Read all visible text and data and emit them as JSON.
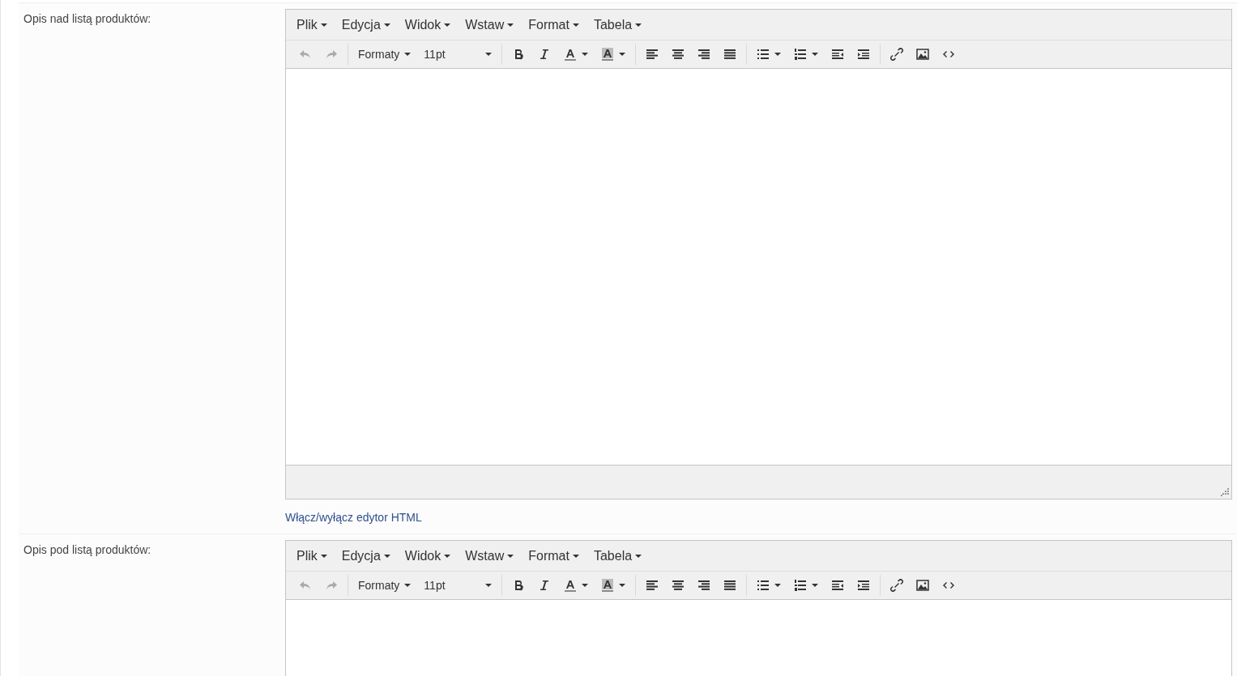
{
  "fields": [
    {
      "label": "Opis nad listą produktów:",
      "editor": {
        "menu": [
          "Plik",
          "Edycja",
          "Widok",
          "Wstaw",
          "Format",
          "Tabela"
        ],
        "toolbar": [
          {
            "items": [
              {
                "kind": "undo",
                "disabled": true
              },
              {
                "kind": "redo",
                "disabled": true
              }
            ]
          },
          {
            "items": [
              {
                "kind": "menu",
                "label": "Formaty",
                "disabled": false
              },
              {
                "kind": "select",
                "label": "11pt",
                "disabled": false
              }
            ]
          },
          {
            "items": [
              {
                "kind": "bold",
                "disabled": false
              },
              {
                "kind": "italic",
                "disabled": false
              },
              {
                "kind": "forecolor",
                "disabled": false
              },
              {
                "kind": "backcolor",
                "disabled": false
              }
            ]
          },
          {
            "items": [
              {
                "kind": "alignleft",
                "disabled": false
              },
              {
                "kind": "aligncenter",
                "disabled": false
              },
              {
                "kind": "alignright",
                "disabled": false
              },
              {
                "kind": "justify",
                "disabled": false
              }
            ]
          },
          {
            "items": [
              {
                "kind": "bullist",
                "disabled": false
              },
              {
                "kind": "numlist",
                "disabled": false
              },
              {
                "kind": "outdent",
                "disabled": false
              },
              {
                "kind": "indent",
                "disabled": false
              }
            ]
          },
          {
            "items": [
              {
                "kind": "link",
                "disabled": false
              },
              {
                "kind": "image",
                "disabled": false
              },
              {
                "kind": "code",
                "disabled": false
              }
            ]
          }
        ],
        "statusbar": true
      },
      "toggle_link": "Włącz/wyłącz edytor HTML"
    },
    {
      "label": "Opis pod listą produktów:",
      "editor": {
        "menu": [
          "Plik",
          "Edycja",
          "Widok",
          "Wstaw",
          "Format",
          "Tabela"
        ],
        "toolbar": [
          {
            "items": [
              {
                "kind": "undo",
                "disabled": true
              },
              {
                "kind": "redo",
                "disabled": true
              }
            ]
          },
          {
            "items": [
              {
                "kind": "menu",
                "label": "Formaty",
                "disabled": false
              },
              {
                "kind": "select",
                "label": "11pt",
                "disabled": false
              }
            ]
          },
          {
            "items": [
              {
                "kind": "bold",
                "disabled": false
              },
              {
                "kind": "italic",
                "disabled": false
              },
              {
                "kind": "forecolor",
                "disabled": false
              },
              {
                "kind": "backcolor",
                "disabled": false
              }
            ]
          },
          {
            "items": [
              {
                "kind": "alignleft",
                "disabled": false
              },
              {
                "kind": "aligncenter",
                "disabled": false
              },
              {
                "kind": "alignright",
                "disabled": false
              },
              {
                "kind": "justify",
                "disabled": false
              }
            ]
          },
          {
            "items": [
              {
                "kind": "bullist",
                "disabled": false
              },
              {
                "kind": "numlist",
                "disabled": false
              },
              {
                "kind": "outdent",
                "disabled": false
              },
              {
                "kind": "indent",
                "disabled": false
              }
            ]
          },
          {
            "items": [
              {
                "kind": "link",
                "disabled": false
              },
              {
                "kind": "image",
                "disabled": false
              },
              {
                "kind": "code",
                "disabled": false
              }
            ]
          }
        ],
        "statusbar": false
      }
    }
  ]
}
